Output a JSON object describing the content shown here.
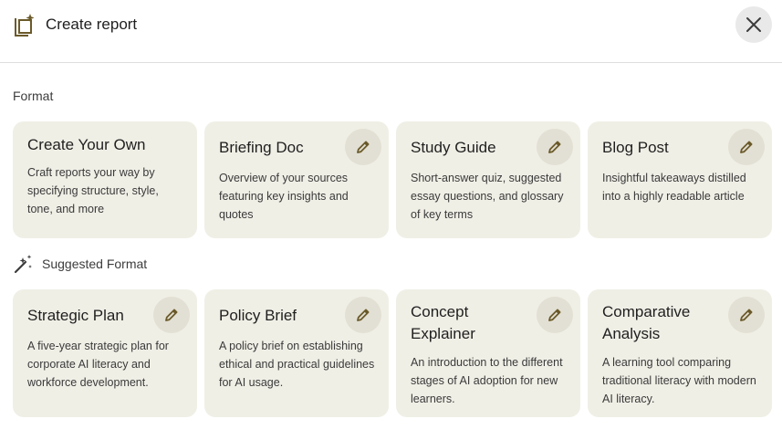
{
  "header": {
    "title": "Create report",
    "icons": {
      "report": "report-sparkle-icon",
      "close": "close-icon"
    }
  },
  "sections": {
    "format": "Format",
    "suggested": "Suggested Format"
  },
  "format_cards": [
    {
      "title": "Create Your Own",
      "description": "Craft reports your way by specifying structure, style, tone, and more"
    },
    {
      "title": "Briefing Doc",
      "description": "Overview of your sources featuring key insights and quotes"
    },
    {
      "title": "Study Guide",
      "description": "Short-answer quiz, suggested essay questions, and glossary of key terms"
    },
    {
      "title": "Blog Post",
      "description": "Insightful takeaways distilled into a highly readable article"
    }
  ],
  "suggested_cards": [
    {
      "title": "Strategic Plan",
      "description": "A five-year strategic plan for corporate AI literacy and workforce development."
    },
    {
      "title": "Policy Brief",
      "description": "A policy brief on establishing ethical and practical guidelines for AI usage."
    },
    {
      "title": "Concept Explainer",
      "description": "An introduction to the different stages of AI adoption for new learners."
    },
    {
      "title": "Comparative Analysis",
      "description": "A learning tool comparing traditional literacy with modern AI literacy."
    }
  ],
  "colors": {
    "card_bg": "#f0efe6",
    "edit_bg": "#e2e0d4",
    "icon_accent": "#6b5a2a"
  }
}
